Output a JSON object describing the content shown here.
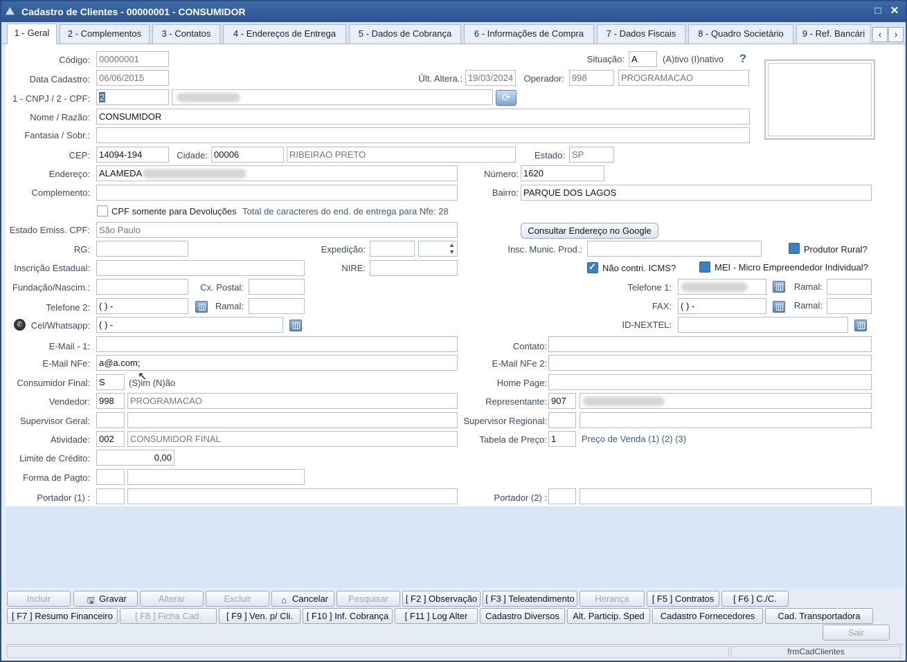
{
  "window": {
    "title": "Cadastro de Clientes - 00000001 - CONSUMIDOR",
    "icon": "app-icon",
    "maximize_icon": "maximize-icon",
    "close_icon": "close-icon"
  },
  "tabs": [
    {
      "label": "1 - Geral"
    },
    {
      "label": "2 - Complementos"
    },
    {
      "label": "3 - Contatos"
    },
    {
      "label": "4 - Endereços de Entrega"
    },
    {
      "label": "5 - Dados de Cobrança"
    },
    {
      "label": "6 - Informações de Compra"
    },
    {
      "label": "7 - Dados Fiscais"
    },
    {
      "label": "8 - Quadro Societário"
    },
    {
      "label": "9 - Ref. Bancári"
    }
  ],
  "tab_nav": {
    "prev": "‹",
    "next": "›"
  },
  "labels": {
    "codigo": "Código:",
    "data_cadastro": "Data Cadastro:",
    "cnpj_cpf": "1 - CNPJ / 2 - CPF:",
    "nome": "Nome / Razão:",
    "fantasia": "Fantasia / Sobr.:",
    "cep": "CEP:",
    "cidade": "Cidade:",
    "estado": "Estado:",
    "endereco": "Endereço:",
    "numero": "Número:",
    "complemento": "Complemento:",
    "bairro": "Bairro:",
    "cpf_devolucoes": "CPF somente para Devoluções",
    "total_caracteres": "Total de caracteres do end. de entrega para Nfe: 28",
    "estado_emiss": "Estado Emiss. CPF:",
    "rg": "RG:",
    "expedicao": "Expedição:",
    "insc_munic": "Insc. Munic. Prod.:",
    "produtor_rural": "Produtor Rural?",
    "inscricao_estadual": "Inscrição Estadual:",
    "nire": "NIRE:",
    "nao_contri": "Não contri. ICMS?",
    "mei": "MEI - Micro Empreendedor Individual?",
    "fundacao": "Fundação/Nascim.:",
    "cx_postal": "Cx. Postal:",
    "telefone1": "Telefone 1:",
    "ramal": "Ramal:",
    "telefone2": "Telefone 2:",
    "fax": "FAX:",
    "cel_whatsapp": "Cel/Whatsapp:",
    "id_nextel": "ID-NEXTEL:",
    "email1": "E-Mail - 1:",
    "contato": "Contato:",
    "email_nfe": "E-Mail NFe:",
    "email_nfe2": "E-Mail NFe 2:",
    "consumidor_final": "Consumidor Final:",
    "sn_hint": "(S)im (N)ão",
    "home_page": "Home Page:",
    "vendedor": "Vendedor:",
    "representante": "Representante:",
    "supervisor_geral": "Supervisor Geral:",
    "supervisor_regional": "Supervisor Regional:",
    "atividade": "Atividade:",
    "tabela_preco": "Tabela de Preço:",
    "preco_venda": "Preço de Venda  (1) (2) (3)",
    "limite_credito": "Limite de Crédito:",
    "forma_pagto": "Forma de Pagto:",
    "portador1": "Portador (1) :",
    "portador2": "Portador (2) :",
    "situacao": "Situação:",
    "situacao_hint": "(A)tivo (I)nativo",
    "ult_altera": "Últ. Altera.:",
    "operador": "Operador:"
  },
  "values": {
    "codigo": "00000001",
    "data_cadastro": "06/06/2015",
    "tipo_doc": "2",
    "nome": "CONSUMIDOR",
    "fantasia": "",
    "cep": "14094-194",
    "cidade_cod": "00006",
    "cidade_nome": "RIBEIRAO PRETO",
    "estado": "SP",
    "endereco": "ALAMEDA",
    "numero": "1620",
    "complemento": "",
    "bairro": "PARQUE DOS LAGOS",
    "estado_emiss": "São Paulo",
    "rg": "",
    "inscricao_estadual": "",
    "nire": "",
    "insc_munic": "",
    "telefone2": "(  )     -",
    "fax": "(  )     -",
    "cel_whatsapp": "(  )     -",
    "email1": "",
    "email_nfe": "a@a.com;",
    "consumidor_final": "S",
    "vendedor_cod": "998",
    "vendedor_nome": "PROGRAMACAO",
    "representante_cod": "907",
    "atividade_cod": "002",
    "atividade_nome": "CONSUMIDOR FINAL",
    "tabela_preco": "1",
    "limite_credito": "0,00",
    "situacao": "A",
    "ult_altera": "19/03/2024",
    "operador_cod": "998",
    "operador_nome": "PROGRAMACAO"
  },
  "icons": {
    "help": "help-icon",
    "refresh": "refresh-icon",
    "whatsapp": "whatsapp-icon",
    "calendar": "calendar-icon"
  },
  "buttons": {
    "row1": [
      {
        "label": "Incluir",
        "enabled": false
      },
      {
        "label": "Gravar",
        "enabled": true,
        "icon": "save-icon"
      },
      {
        "label": "Alterar",
        "enabled": false
      },
      {
        "label": "Excluir",
        "enabled": false
      },
      {
        "label": "Cancelar",
        "enabled": true,
        "icon": "cancel-icon"
      },
      {
        "label": "Pesquisar",
        "enabled": false
      },
      {
        "label": "[ F2 ] Observação",
        "enabled": true
      },
      {
        "label": "[ F3 ] Teleatendimento",
        "enabled": true
      },
      {
        "label": "Herança",
        "enabled": false
      },
      {
        "label": "[ F5 ] Contratos",
        "enabled": true
      },
      {
        "label": "[ F6 ] C./C.",
        "enabled": true
      }
    ],
    "row2": [
      {
        "label": "[ F7 ] Resumo Financeiro",
        "enabled": true
      },
      {
        "label": "[ F8 ] Ficha Cad.",
        "enabled": false
      },
      {
        "label": "[ F9 ] Ven. p/ Cli.",
        "enabled": true
      },
      {
        "label": "[ F10 ] Inf. Cobrança",
        "enabled": true
      },
      {
        "label": "[ F11 ] Log Alter",
        "enabled": true
      },
      {
        "label": "Cadastro Diversos",
        "enabled": true
      },
      {
        "label": "Alt. Particip. Sped",
        "enabled": true
      },
      {
        "label": "Cadastro Fornecedores",
        "enabled": true
      },
      {
        "label": "Cad. Transportadora",
        "enabled": true
      }
    ],
    "sair": "Sair",
    "google": "Consultar Endereço no Google"
  },
  "status": {
    "form_name": "frmCadClientes"
  }
}
